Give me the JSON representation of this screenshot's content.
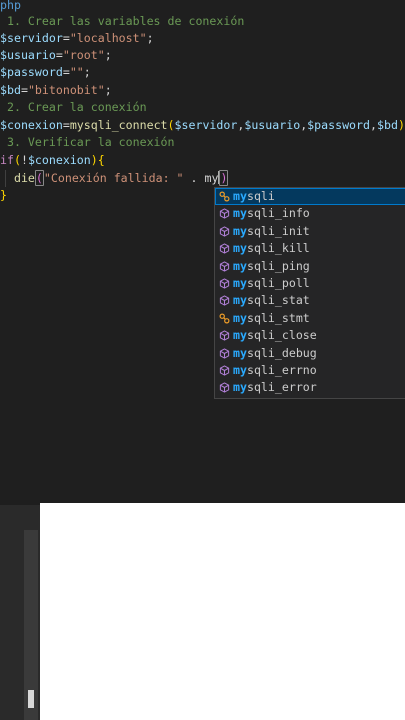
{
  "editor": {
    "header_fragment": "php",
    "comment_1": " 1. Crear las variables de conexión",
    "comment_2": " 2. Crear la conexión",
    "comment_3": " 3. Verificar la conexión",
    "servidor": {
      "name": "$servidor",
      "value": "\"localhost\""
    },
    "usuario": {
      "name": "$usuario",
      "value": "\"root\""
    },
    "password": {
      "name": "$password",
      "value": "\"\""
    },
    "bd": {
      "name": "$bd",
      "value": "\"bitonobit\""
    },
    "conexion_var": "$conexion",
    "connect_fn": "mysqli_connect",
    "connect_args": [
      "$servidor",
      "$usuario",
      "$password",
      "$bd"
    ],
    "if_kw": "if",
    "if_var": "$conexion",
    "die_fn": "die",
    "die_str": "\"Conexión fallida: \"",
    "die_typed": "my",
    "close_brace": "}"
  },
  "suggestions": {
    "typed_prefix": "my",
    "items": [
      {
        "label": "mysqli",
        "kind": "class"
      },
      {
        "label": "mysqli_info",
        "kind": "function"
      },
      {
        "label": "mysqli_init",
        "kind": "function"
      },
      {
        "label": "mysqli_kill",
        "kind": "function"
      },
      {
        "label": "mysqli_ping",
        "kind": "function"
      },
      {
        "label": "mysqli_poll",
        "kind": "function"
      },
      {
        "label": "mysqli_stat",
        "kind": "function"
      },
      {
        "label": "mysqli_stmt",
        "kind": "class"
      },
      {
        "label": "mysqli_close",
        "kind": "function"
      },
      {
        "label": "mysqli_debug",
        "kind": "function"
      },
      {
        "label": "mysqli_errno",
        "kind": "function"
      },
      {
        "label": "mysqli_error",
        "kind": "function"
      }
    ],
    "selected_index": 0
  },
  "colors": {
    "editor_bg": "#1f1f1f",
    "comment": "#6a9955",
    "variable": "#9cdcfe",
    "string": "#ce9178",
    "function": "#dcdcaa",
    "keyword": "#c586c0",
    "match": "#2aaaff",
    "selected_bg": "#04395e"
  }
}
